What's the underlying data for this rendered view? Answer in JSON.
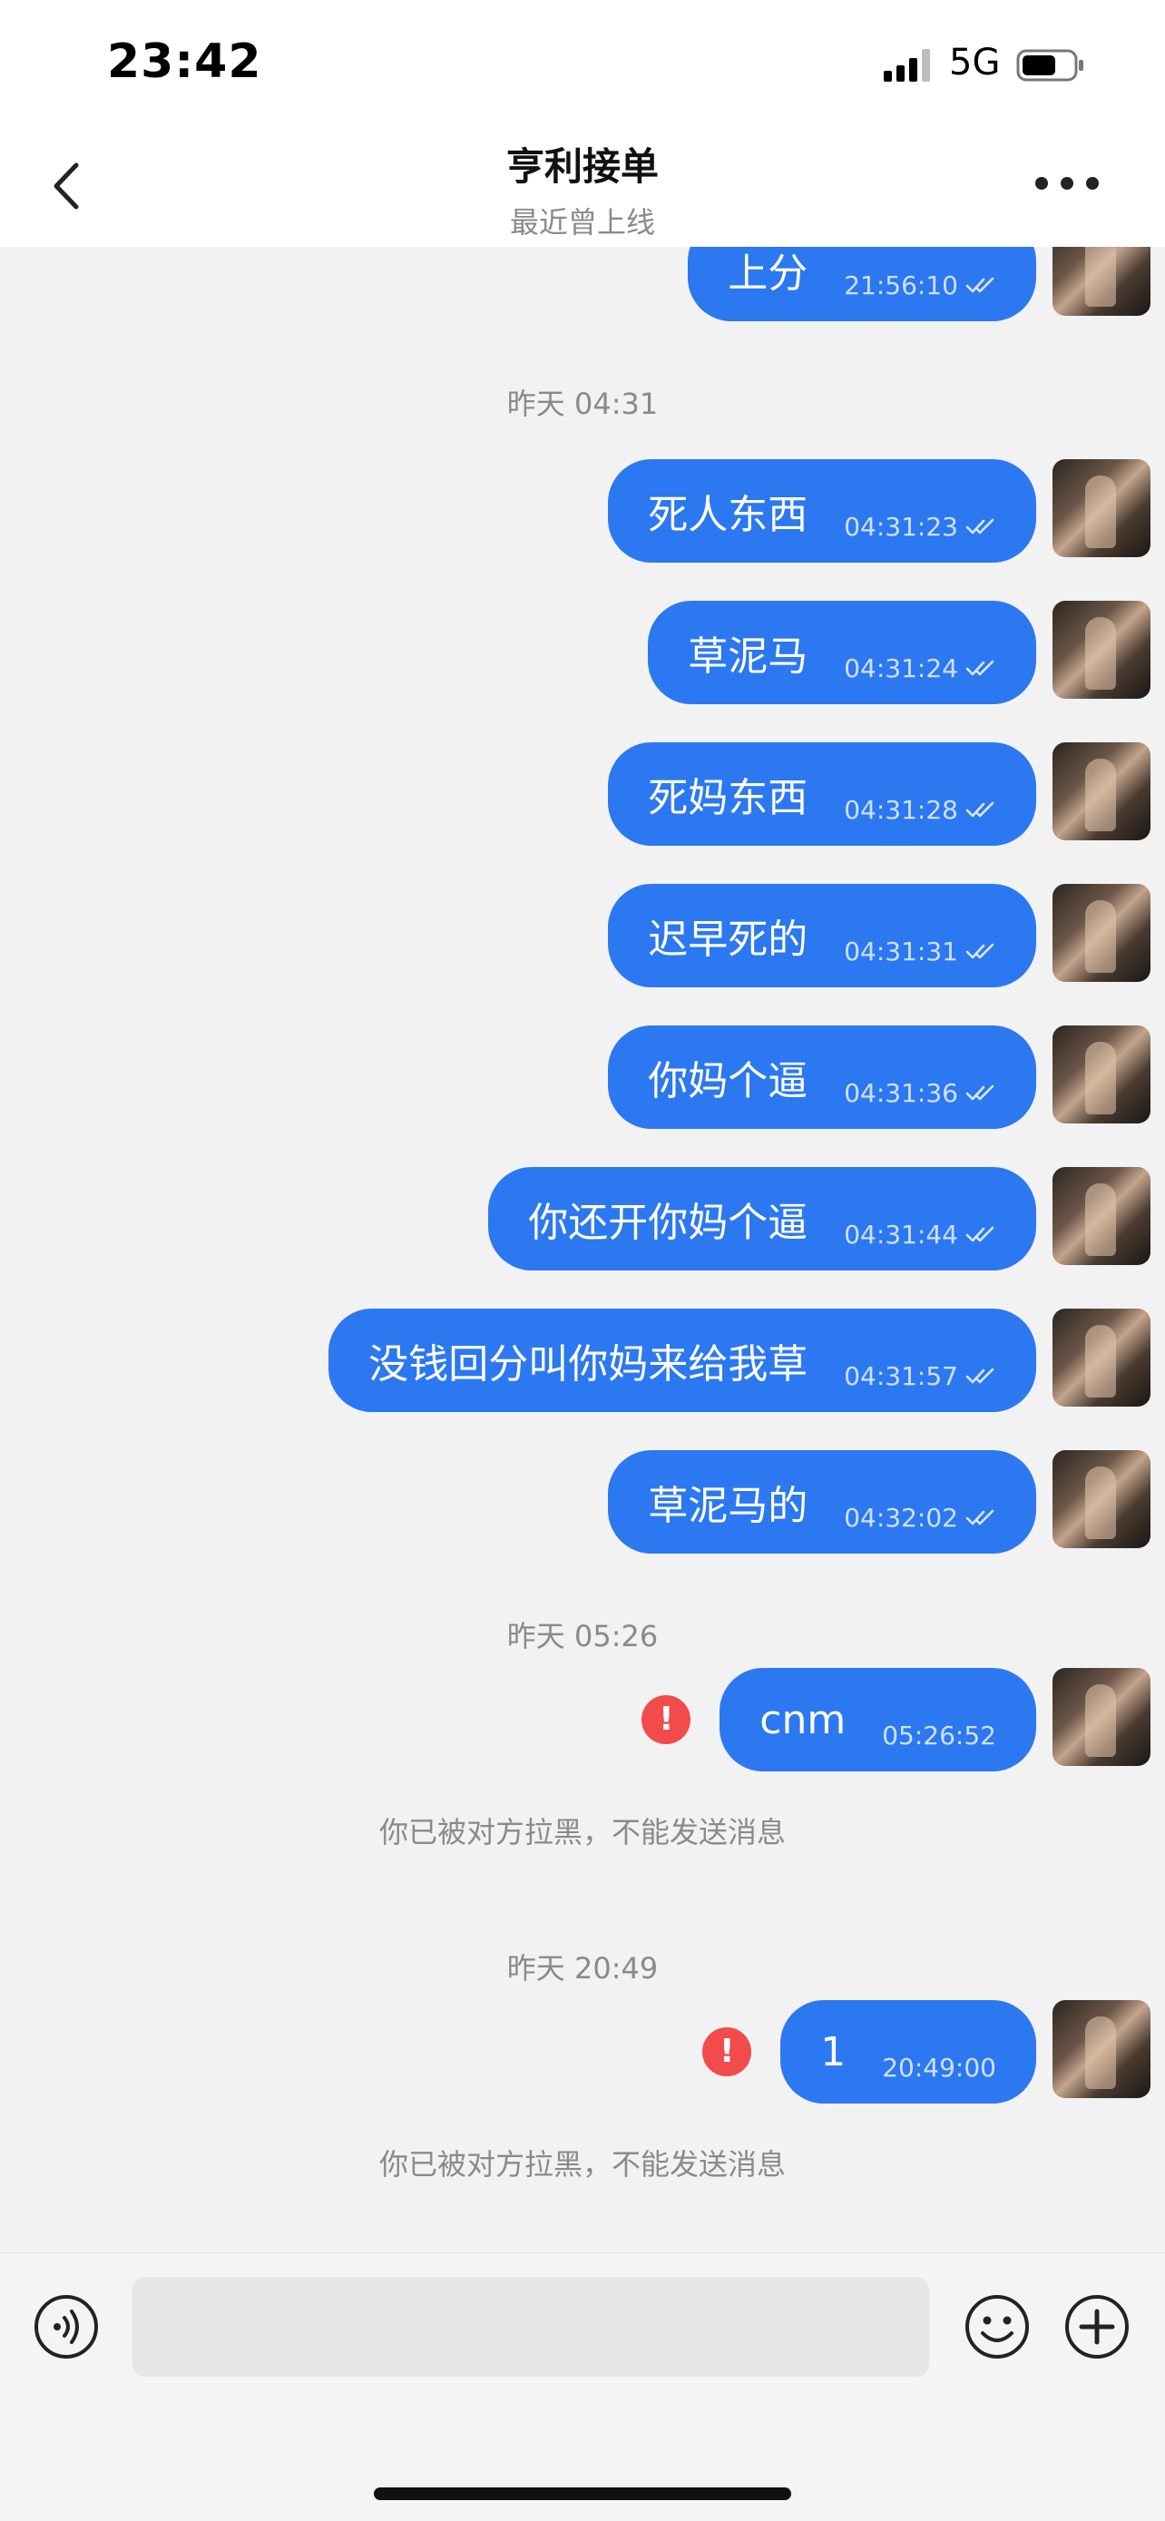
{
  "status_bar": {
    "time": "23:42",
    "network": "5G"
  },
  "header": {
    "title": "亨利接单",
    "subtitle": "最近曾上线"
  },
  "messages": [
    {
      "type": "message",
      "text": "上分",
      "time": "21:56:10"
    },
    {
      "type": "date",
      "text": "昨天 04:31"
    },
    {
      "type": "message",
      "text": "死人东西",
      "time": "04:31:23"
    },
    {
      "type": "message",
      "text": "草泥马",
      "time": "04:31:24"
    },
    {
      "type": "message",
      "text": "死妈东西",
      "time": "04:31:28"
    },
    {
      "type": "message",
      "text": "迟早死的",
      "time": "04:31:31"
    },
    {
      "type": "message",
      "text": "你妈个逼",
      "time": "04:31:36"
    },
    {
      "type": "message",
      "text": "你还开你妈个逼",
      "time": "04:31:44"
    },
    {
      "type": "message",
      "text": "没钱回分叫你妈来给我草",
      "time": "04:31:57"
    },
    {
      "type": "message",
      "text": "草泥马的",
      "time": "04:32:02"
    },
    {
      "type": "date",
      "text": "昨天 05:26"
    },
    {
      "type": "message",
      "text": "cnm",
      "time": "05:26:52",
      "failed": true
    },
    {
      "type": "notice",
      "text": "你已被对方拉黑，不能发送消息"
    },
    {
      "type": "date",
      "text": "昨天 20:49"
    },
    {
      "type": "message",
      "text": "1",
      "time": "20:49:00",
      "failed": true
    },
    {
      "type": "notice",
      "text": "你已被对方拉黑，不能发送消息"
    }
  ],
  "input": {
    "placeholder": ""
  },
  "colors": {
    "bubble": "#2c78f1",
    "error": "#f24b4b",
    "background": "#f2f2f2"
  },
  "icons": [
    "back-icon",
    "more-icon",
    "read-check-icon",
    "error-icon",
    "voice-icon",
    "emoji-icon",
    "plus-icon"
  ]
}
